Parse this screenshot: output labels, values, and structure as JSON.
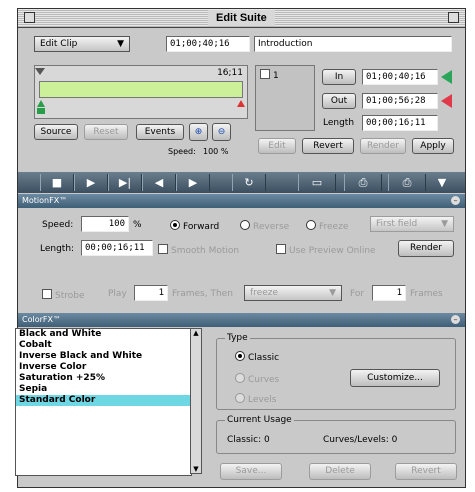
{
  "window": {
    "title": "Edit Suite"
  },
  "top": {
    "mode_popup": "Edit Clip",
    "timecode": "01;00;40;16",
    "clip_name": "Introduction"
  },
  "timeline": {
    "duration": "16;11",
    "bar_color": "#ccf09a",
    "position": 0.0
  },
  "clip_buttons": {
    "source": "Source",
    "reset": "Reset",
    "events": "Events"
  },
  "speed_label": "Speed:",
  "speed_value": "100 %",
  "thumb": {
    "check_label": "1"
  },
  "inout": {
    "in_label": "In",
    "in_value": "01;00;40;16",
    "out_label": "Out",
    "out_value": "01;00;56;28",
    "length_label": "Length",
    "length_value": "00;00;16;11"
  },
  "action_buttons": {
    "edit": "Edit",
    "revert": "Revert",
    "render": "Render",
    "apply": "Apply"
  },
  "motion": {
    "title": "MotionFX™",
    "speed_label": "Speed:",
    "speed_value": "100",
    "percent": "%",
    "direction": [
      "Forward",
      "Reverse",
      "Freeze"
    ],
    "direction_selected": "Forward",
    "field_popup": "First field",
    "length_label": "Length:",
    "length_value": "00;00;16;11",
    "smooth_motion": "Smooth Motion",
    "use_preview": "Use Preview Online",
    "render": "Render",
    "strobe": "Strobe",
    "play": "Play",
    "play_value": "1",
    "frames_then": "Frames, Then",
    "then_popup": "freeze",
    "for": "For",
    "for_value": "1",
    "frames": "Frames"
  },
  "color": {
    "title": "ColorFX™",
    "effects": [
      "Black and White",
      "Cobalt",
      "Inverse Black and White",
      "Inverse Color",
      "Saturation +25%",
      "Sepia",
      "Standard Color"
    ],
    "selected": "Standard Color",
    "type_title": "Type",
    "types": [
      "Classic",
      "Curves",
      "Levels"
    ],
    "type_selected": "Classic",
    "customize": "Customize...",
    "usage_title": "Current Usage",
    "classic_usage": "Classic: 0",
    "curves_usage": "Curves/Levels: 0",
    "save": "Save...",
    "delete": "Delete",
    "revert": "Revert"
  }
}
